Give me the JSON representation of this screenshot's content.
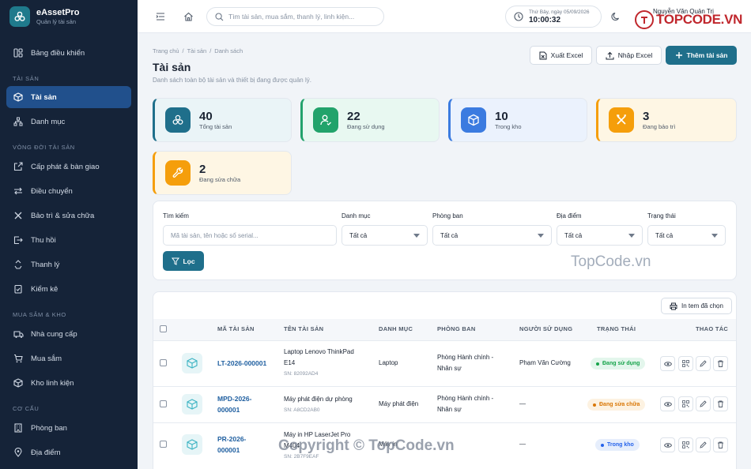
{
  "app": {
    "name": "eAssetPro",
    "subtitle": "Quản lý tài sản"
  },
  "sidebar": {
    "dashboard": "Bảng điều khiển",
    "sections": [
      {
        "title": "TÀI SẢN",
        "items": [
          {
            "label": "Tài sản",
            "active": true
          },
          {
            "label": "Danh mục"
          }
        ]
      },
      {
        "title": "VÒNG ĐỜI TÀI SẢN",
        "items": [
          {
            "label": "Cấp phát & bàn giao"
          },
          {
            "label": "Điều chuyển"
          },
          {
            "label": "Bảo trì & sửa chữa"
          },
          {
            "label": "Thu hồi"
          },
          {
            "label": "Thanh lý"
          },
          {
            "label": "Kiểm kê"
          }
        ]
      },
      {
        "title": "MUA SẮM & KHO",
        "items": [
          {
            "label": "Nhà cung cấp"
          },
          {
            "label": "Mua sắm"
          },
          {
            "label": "Kho linh kiện"
          }
        ]
      },
      {
        "title": "CƠ CẤU",
        "items": [
          {
            "label": "Phòng ban"
          },
          {
            "label": "Địa điểm"
          }
        ]
      }
    ]
  },
  "topbar": {
    "search_placeholder": "Tìm tài sản, mua sắm, thanh lý, linh kiện...",
    "date": "Thứ Bảy, ngày 05/09/2026",
    "time": "10:00:32",
    "user": "Nguyễn Văn Quản Trị"
  },
  "breadcrumb": [
    "Trang chủ",
    "/",
    "Tài sản",
    "/",
    "Danh sách"
  ],
  "page": {
    "title": "Tài sản",
    "subtitle": "Danh sách toàn bộ tài sản và thiết bị đang được quản lý."
  },
  "actions": {
    "export": "Xuất Excel",
    "import": "Nhập Excel",
    "add": "Thêm tài sản"
  },
  "stats": [
    {
      "value": "40",
      "label": "Tổng tài sản",
      "color": "#1f6f8b",
      "icon": "boxes-icon"
    },
    {
      "value": "22",
      "label": "Đang sử dụng",
      "color": "#22a36b",
      "icon": "user-check-icon"
    },
    {
      "value": "10",
      "label": "Trong kho",
      "color": "#3b7be0",
      "icon": "box-icon"
    },
    {
      "value": "3",
      "label": "Đang bảo trì",
      "color": "#f59e0b",
      "icon": "tools-icon"
    },
    {
      "value": "2",
      "label": "Đang sửa chữa",
      "color": "#f59e0b",
      "icon": "wrench-icon"
    }
  ],
  "filters": {
    "search_label": "Tìm kiếm",
    "search_placeholder": "Mã tài sản, tên hoặc số serial...",
    "category_label": "Danh mục",
    "category_value": "Tất cả",
    "dept_label": "Phòng ban",
    "dept_value": "Tất cả",
    "location_label": "Địa điểm",
    "location_value": "Tất cả",
    "status_label": "Trạng thái",
    "status_value": "Tất cả",
    "filter_button": "Lọc"
  },
  "table": {
    "print_button": "In tem đã chọn",
    "columns": [
      "MÃ TÀI SẢN",
      "TÊN TÀI SẢN",
      "DANH MỤC",
      "PHÒNG BAN",
      "NGƯỜI SỬ DỤNG",
      "TRẠNG THÁI",
      "THAO TÁC"
    ],
    "rows": [
      {
        "code1": "LT-2026-000001",
        "code2": "",
        "name1": "Laptop Lenovo ThinkPad",
        "name2": "E14",
        "sn": "SN: 82092AD4",
        "category": "Laptop",
        "dept1": "Phòng Hành chính -",
        "dept2": "Nhân sự",
        "user": "Phạm Văn Cường",
        "status": "Đang sử dụng",
        "status_color": "#16a34a",
        "status_bg": "#e3f6ec"
      },
      {
        "code1": "MPD-2026-",
        "code2": "000001",
        "name1": "Máy phát điện dự phòng",
        "name2": "",
        "sn": "SN: A8CD2AB0",
        "category": "Máy phát điện",
        "dept1": "Phòng Hành chính -",
        "dept2": "Nhân sự",
        "user": "—",
        "status": "Đang sửa chữa",
        "status_color": "#d97706",
        "status_bg": "#fdf2e1"
      },
      {
        "code1": "PR-2026-",
        "code2": "000001",
        "name1": "Máy in HP LaserJet Pro",
        "name2": "M404",
        "sn": "SN: 2B7F9EAF",
        "category": "Máy in",
        "dept1": "",
        "dept2": "",
        "user": "—",
        "status": "Trong kho",
        "status_color": "#2563eb",
        "status_bg": "#e6eefc"
      }
    ]
  },
  "watermarks": {
    "logo": "TOPCODE.VN",
    "mid": "TopCode.vn",
    "bottom": "Copyright © TopCode.vn"
  }
}
